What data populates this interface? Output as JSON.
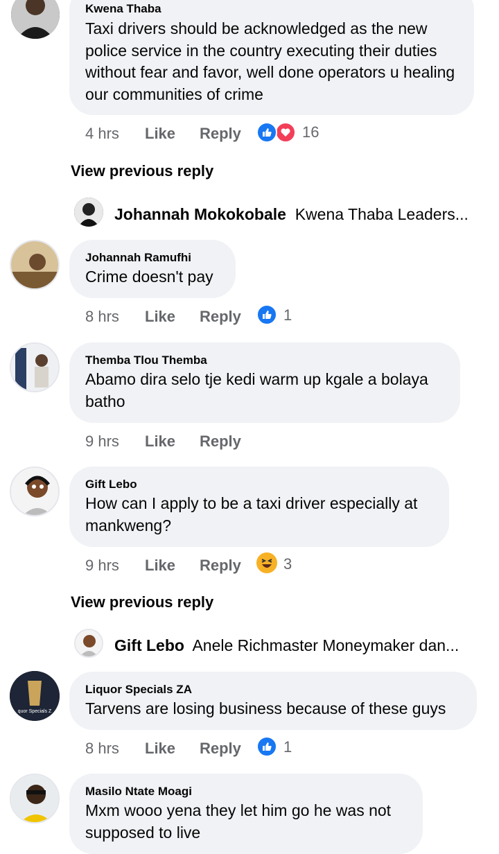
{
  "comments": [
    {
      "name": "Kwena Thaba",
      "text": "Taxi drivers should be acknowledged as the new police service in the country executing their duties without fear and favor, well done operators u healing our communities of crime",
      "time": "4 hrs",
      "like": "Like",
      "reply": "Reply",
      "reactions": [
        "like-icon",
        "love-icon"
      ],
      "count": "16"
    },
    {
      "name": "Johannah Ramufhi",
      "text": "Crime doesn't pay",
      "time": "8 hrs",
      "like": "Like",
      "reply": "Reply",
      "reactions": [
        "like-icon"
      ],
      "count": "1"
    },
    {
      "name": "Themba Tlou Themba",
      "text": "Abamo dira selo tje kedi warm up kgale a bolaya batho",
      "time": "9 hrs",
      "like": "Like",
      "reply": "Reply",
      "reactions": [],
      "count": ""
    },
    {
      "name": "Gift Lebo",
      "text": "How can I apply to be a taxi driver especially at mankweng?",
      "time": "9 hrs",
      "like": "Like",
      "reply": "Reply",
      "reactions": [
        "haha-icon"
      ],
      "count": "3"
    },
    {
      "name": "Liquor Specials ZA",
      "text": "Tarvens are losing business because of these guys",
      "time": "8 hrs",
      "like": "Like",
      "reply": "Reply",
      "reactions": [
        "like-icon"
      ],
      "count": "1"
    },
    {
      "name": "Masilo Ntate Moagi",
      "text": "Mxm wooo yena they let him go he was not supposed to live",
      "time": "",
      "like": "",
      "reply": "",
      "reactions": [],
      "count": ""
    }
  ],
  "view_previous": [
    "View previous reply",
    "View previous reply"
  ],
  "collapsed_replies": [
    {
      "name": "Johannah Mokokobale",
      "text": "Kwena Thaba Leaders..."
    },
    {
      "name": "Gift Lebo",
      "text": "Anele Richmaster Moneymaker dan..."
    }
  ],
  "avatar_text": {
    "liquor": "quor Specials Z"
  },
  "colors": {
    "bubble": "#f0f2f5",
    "meta": "#65676b",
    "like_blue": "#1877f2",
    "love_red": "#f33e58",
    "haha_yellow": "#f7b125"
  }
}
